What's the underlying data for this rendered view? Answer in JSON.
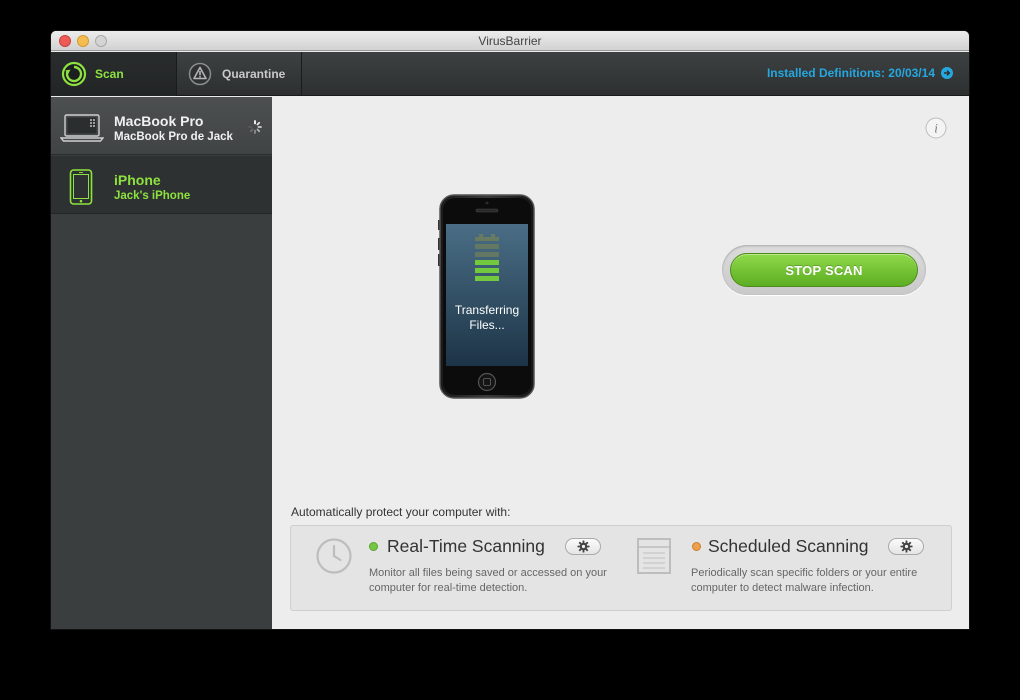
{
  "window": {
    "title": "VirusBarrier"
  },
  "toolbar": {
    "tabs": [
      {
        "label": "Scan",
        "icon": "scan-icon",
        "active": true
      },
      {
        "label": "Quarantine",
        "icon": "warning-icon",
        "active": false
      }
    ],
    "definitions": "Installed Definitions: 20/03/14",
    "definitions_icon": "arrow-right-circle-icon"
  },
  "sidebar": {
    "devices": [
      {
        "name": "MacBook Pro",
        "subtitle": "MacBook Pro de Jack",
        "icon": "laptop-icon",
        "busy": true
      },
      {
        "name": "iPhone",
        "subtitle": "Jack's iPhone",
        "icon": "iphone-icon",
        "selected": true
      }
    ]
  },
  "main": {
    "status": "Transferring Files...",
    "progress_segments": {
      "total": 6,
      "filled": 3
    },
    "stop_button": "STOP SCAN",
    "info_icon": "info-icon",
    "auto_title": "Automatically protect your computer with:",
    "features": [
      {
        "title": "Real-Time Scanning",
        "description": "Monitor all files being saved or accessed on your computer for real-time detection.",
        "status_color": "#76c843",
        "icon": "clock-icon"
      },
      {
        "title": "Scheduled Scanning",
        "description": "Periodically scan specific folders or your entire computer to detect malware infection.",
        "status_color": "#f0a04b",
        "icon": "calendar-icon"
      }
    ]
  },
  "colors": {
    "accent_green": "#8ee23f",
    "link_blue": "#25a7e0",
    "button_green": "#5cae22"
  }
}
